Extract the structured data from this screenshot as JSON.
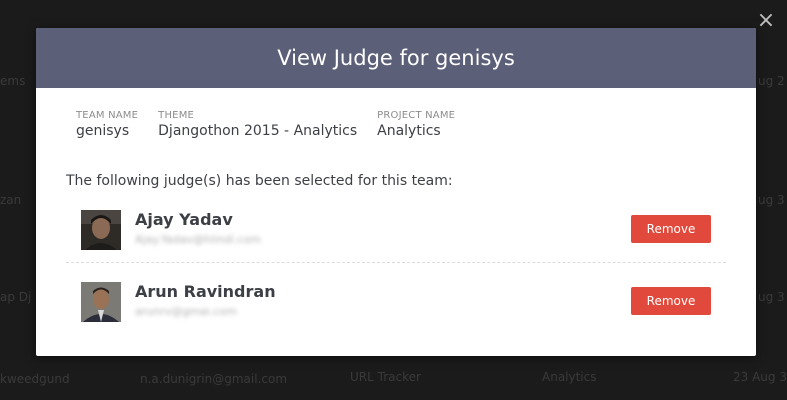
{
  "background": {
    "rows": [
      {
        "c1": "ems",
        "c5": "ug 2"
      },
      {
        "c1": "zan",
        "c5": "ug 3"
      },
      {
        "c1": "ap Dj",
        "c5": "ug 3"
      },
      {
        "c1": "kweedgund",
        "c2": "n.a.dunigrin@gmail.com",
        "c3": "URL Tracker",
        "c4": "Analytics",
        "c5": "23 Aug 3"
      }
    ]
  },
  "modal": {
    "title": "View Judge for genisys",
    "close_icon": "×",
    "team": {
      "team_name_label": "TEAM NAME",
      "team_name": "genisys",
      "theme_label": "THEME",
      "theme": "Djangothon 2015 - Analytics",
      "project_name_label": "PROJECT NAME",
      "project_name": "Analytics"
    },
    "intro": "The following judge(s) has been selected for this team:",
    "judges": [
      {
        "name": "Ajay Yadav",
        "email": "Ajay.Yadav@hiindi.com",
        "remove_label": "Remove"
      },
      {
        "name": "Arun Ravindran",
        "email": "arunrv@gmai.com",
        "remove_label": "Remove"
      }
    ]
  },
  "colors": {
    "header_bg": "#5b5f78",
    "remove_bg": "#e0493b",
    "overlay_bg": "#1b1b1b"
  }
}
